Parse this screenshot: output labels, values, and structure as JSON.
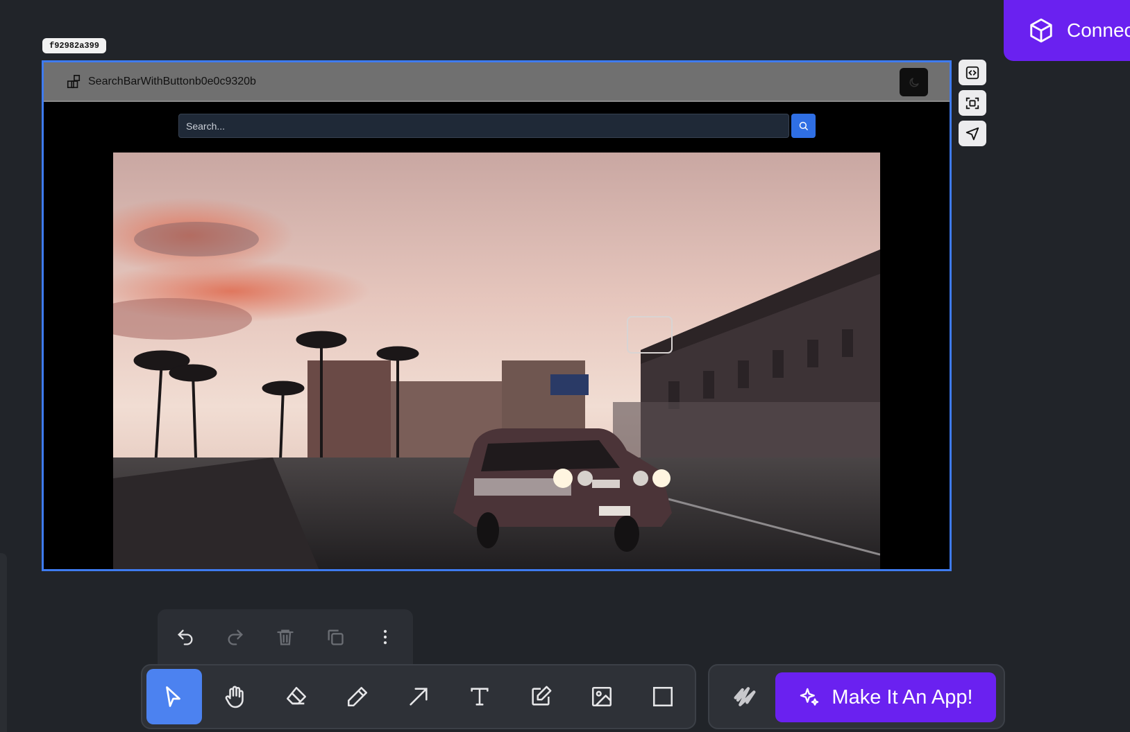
{
  "connect": {
    "label": "Connec",
    "icon": "cube-icon"
  },
  "frame": {
    "id_tag": "f92982a399",
    "component_name": "SearchBarWithButtonb0e0c9320b",
    "component_icon": "component-icon",
    "theme_toggle_icon": "moon-icon",
    "search": {
      "placeholder": "Search...",
      "button_icon": "search-icon"
    },
    "image": {
      "subject": "classic car on street at sunset"
    }
  },
  "side_tools": [
    {
      "name": "code-icon"
    },
    {
      "name": "screenshot-icon"
    },
    {
      "name": "send-icon"
    }
  ],
  "history_tools": [
    {
      "name": "undo-icon",
      "enabled": true
    },
    {
      "name": "redo-icon",
      "enabled": false
    },
    {
      "name": "trash-icon",
      "enabled": false
    },
    {
      "name": "duplicate-icon",
      "enabled": false
    },
    {
      "name": "more-icon",
      "enabled": true
    }
  ],
  "toolbar": {
    "tools": [
      "select",
      "hand",
      "eraser",
      "pencil",
      "arrow",
      "text",
      "note",
      "image",
      "rectangle"
    ],
    "active": "select"
  },
  "ai": {
    "scribble_icon": "scribble-icon",
    "make_app_label": "Make It An App!",
    "make_app_icon": "sparkles-icon"
  },
  "colors": {
    "accent": "#6a21f0",
    "selection": "#3e7bf0",
    "active_tool": "#4c82f0",
    "background": "#212429"
  }
}
